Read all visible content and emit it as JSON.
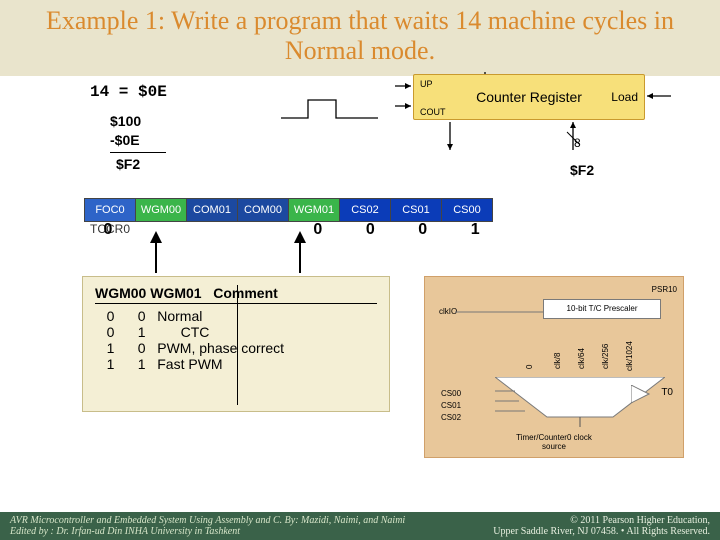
{
  "title": "Example 1: Write a program that waits 14 machine cycles in Normal mode.",
  "hex_eq": "14 = $0E",
  "subtraction": {
    "a": "$100",
    "b": "-$0E",
    "result": "$F2"
  },
  "counter": {
    "up": "UP",
    "cout": "COUT",
    "name": "Counter Register",
    "load": "Load"
  },
  "div8_note": "8",
  "f2_right": "$F2",
  "tccr_cells": [
    "FOC0",
    "WGM00",
    "COM01",
    "COM00",
    "WGM01",
    "CS02",
    "CS01",
    "CS00"
  ],
  "tccr_name": "TCCR0",
  "bit_values": [
    "0",
    "",
    "",
    "",
    "0",
    "0",
    "0",
    "1"
  ],
  "mode_table": {
    "header_l": "WGM00  WGM01",
    "header_r": "Comment",
    "rows": [
      "   0      0   Normal",
      "   0      1         CTC",
      "   1      0   PWM, phase correct",
      "   1      1   Fast PWM"
    ]
  },
  "prescaler": {
    "psr": "PSR10",
    "clk": "clkIO",
    "label": "            10-bit T/C Prescaler",
    "t0": "T0",
    "taps": [
      "0",
      "clk/8",
      "clk/64",
      "clk/256",
      "clk/1024"
    ],
    "cs": [
      "CS00",
      "CS01",
      "CS02"
    ],
    "out": "Timer/Counter0 clock\nsource"
  },
  "footer": {
    "left_l1": "AVR Microcontroller and Embedded System Using Assembly and C. By: Mazidi, Naimi, and Naimi",
    "left_l2": "Edited by : Dr. Irfan-ud Din INHA University in Tashkent",
    "right_l1": "© 2011   Pearson Higher Education,",
    "right_l2": "Upper Saddle River, NJ 07458. • All Rights Reserved."
  }
}
